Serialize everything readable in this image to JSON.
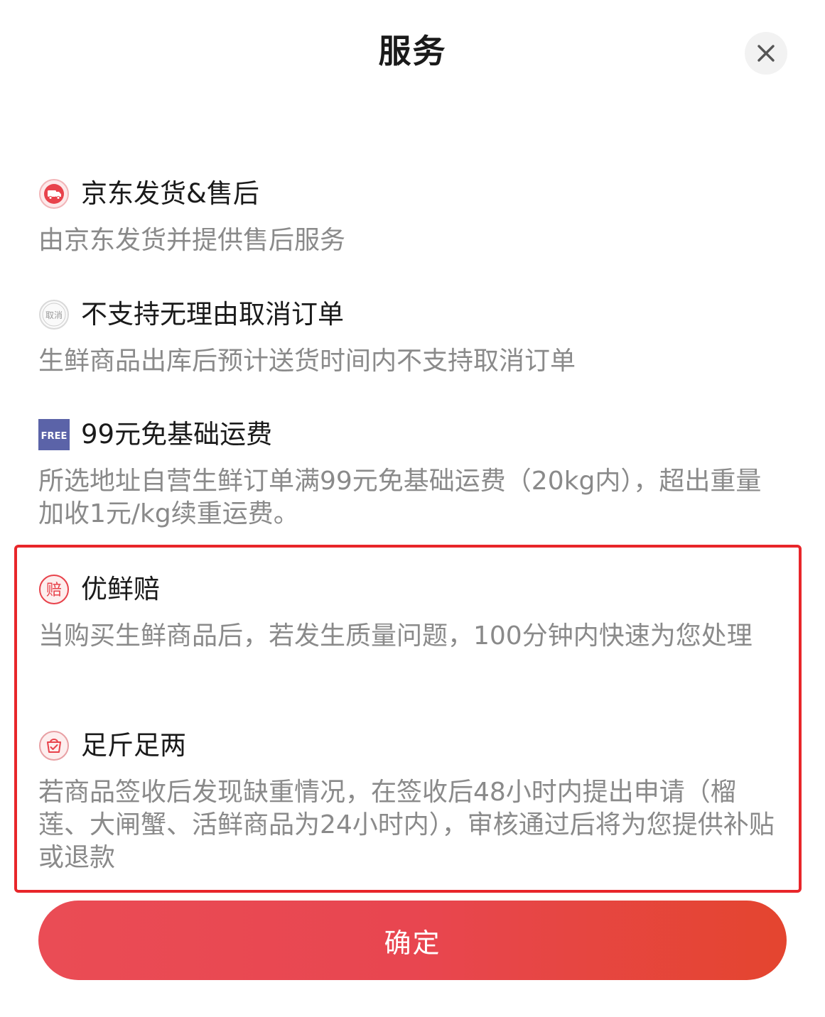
{
  "header": {
    "title": "服务"
  },
  "sections": [
    {
      "icon": "delivery-truck-icon",
      "title": "京东发货&售后",
      "desc": "由京东发货并提供售后服务"
    },
    {
      "icon": "cancel-badge-icon",
      "icon_text": "取消",
      "title": "不支持无理由取消订单",
      "desc": "生鲜商品出库后预计送货时间内不支持取消订单"
    },
    {
      "icon": "free-shipping-icon",
      "icon_text": "FREE",
      "title": "99元免基础运费",
      "desc": "所选地址自营生鲜订单满99元免基础运费（20kg内），超出重量加收1元/kg续重运费。"
    },
    {
      "icon": "compensation-icon",
      "icon_text": "赔",
      "title": "优鲜赔",
      "desc": "当购买生鲜商品后，若发生质量问题，100分钟内快速为您处理"
    },
    {
      "icon": "full-weight-icon",
      "title": "足斤足两",
      "desc": "若商品签收后发现缺重情况，在签收后48小时内提出申请（榴莲、大闸蟹、活鲜商品为24小时内），审核通过后将为您提供补贴或退款"
    }
  ],
  "footer": {
    "confirm_label": "确定"
  },
  "colors": {
    "accent_red": "#e8262a",
    "button_gradient_start": "#ea4c55",
    "button_gradient_end": "#e4452f",
    "free_badge": "#5b63a8",
    "desc_gray": "#8a8a8a"
  }
}
